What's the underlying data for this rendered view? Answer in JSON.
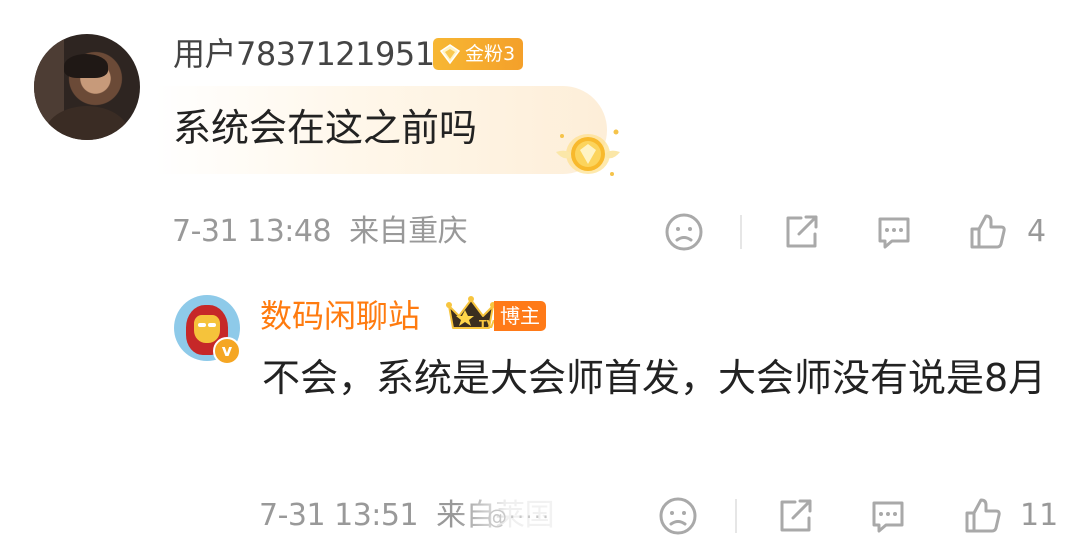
{
  "main_comment": {
    "username": "用户7837121951",
    "fan_badge": "金粉3",
    "text": "系统会在这之前吗",
    "time": "7-31 13:48",
    "location": "来自重庆",
    "like_count": "4"
  },
  "reply": {
    "username": "数码闲聊站",
    "role_badge": "博主",
    "verified_mark": "v",
    "text": "不会，系统是大会师首发，大会师没有说是8月",
    "time": "7-31 13:51",
    "location": "来自莱国",
    "like_count": "11",
    "watermark": "@·····"
  },
  "icons": {
    "dislike": "sad-face-icon",
    "share": "share-icon",
    "comment": "comment-icon",
    "like": "thumbs-up-icon"
  },
  "colors": {
    "orange_name": "#ff7b0f",
    "gold_badge": "#f7b733",
    "meta_gray": "#999999"
  }
}
